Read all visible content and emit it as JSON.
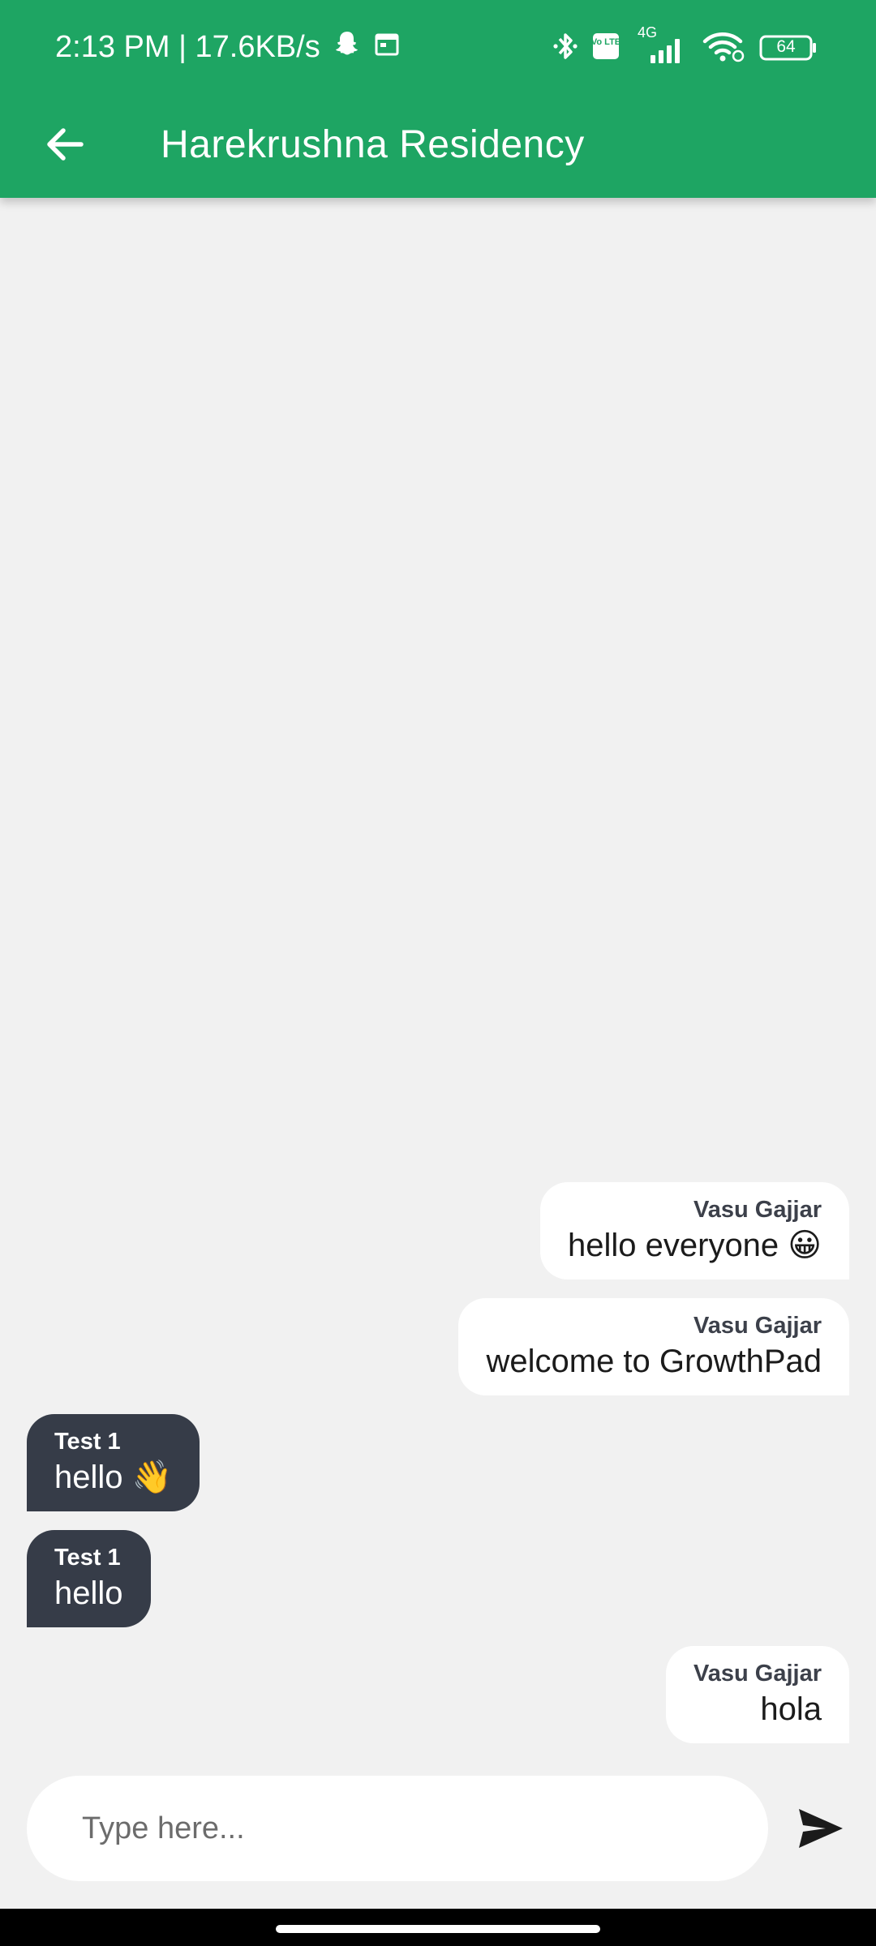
{
  "status_bar": {
    "time_speed": "2:13 PM | 17.6KB/s",
    "network_type": "4G",
    "volte_label": "Vo LTE",
    "battery_level": "64",
    "icons": [
      "snapchat-icon",
      "calendar-icon",
      "bluetooth-icon",
      "volte-icon",
      "signal-icon",
      "wifi-icon",
      "battery-icon"
    ]
  },
  "header": {
    "back_icon": "arrow-left-icon",
    "title": "Harekrushna Residency"
  },
  "messages": [
    {
      "sender": "Vasu Gajjar",
      "text": "hello everyone 😀",
      "mine": true
    },
    {
      "sender": "Vasu Gajjar",
      "text": "welcome to GrowthPad",
      "mine": true
    },
    {
      "sender": "Test 1",
      "text": "hello 👋",
      "mine": false
    },
    {
      "sender": "Test 1",
      "text": "hello",
      "mine": false
    },
    {
      "sender": "Vasu Gajjar",
      "text": "hola",
      "mine": true
    }
  ],
  "composer": {
    "placeholder": "Type here...",
    "value": "",
    "send_icon": "send-icon"
  },
  "colors": {
    "header": "#1ea563",
    "background": "#f1f1f1",
    "own_bubble": "#ffffff",
    "other_bubble": "#363c48"
  }
}
